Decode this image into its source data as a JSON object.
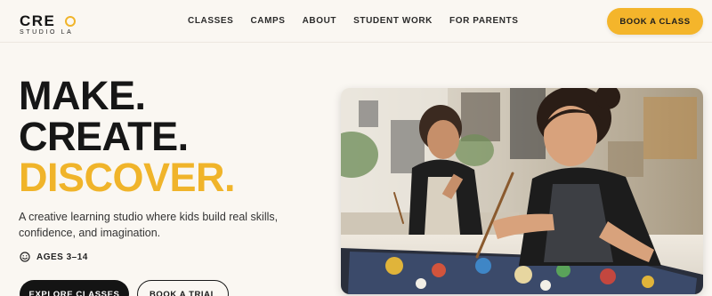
{
  "brand": {
    "logo_main": "CRE",
    "logo_sub": "STUDIO LA"
  },
  "nav": {
    "items": [
      {
        "label": "CLASSES"
      },
      {
        "label": "CAMPS"
      },
      {
        "label": "ABOUT"
      },
      {
        "label": "STUDENT WORK"
      },
      {
        "label": "FOR PARENTS"
      }
    ],
    "cta_label": "BOOK A CLASS"
  },
  "hero": {
    "headline_lines": [
      "MAKE.",
      "CREATE.",
      "DISCOVER."
    ],
    "lede": "A creative learning studio where kids build real skills, confidence, and imagination.",
    "ages_icon": "smiley-icon",
    "ages_label": "AGES 3–14",
    "primary_cta": "EXPLORE CLASSES",
    "secondary_cta": "BOOK A TRIAL"
  },
  "colors": {
    "accent": "#f0b42a",
    "button_yellow": "#f4b52b",
    "dark": "#141414",
    "background": "#faf7f2"
  }
}
